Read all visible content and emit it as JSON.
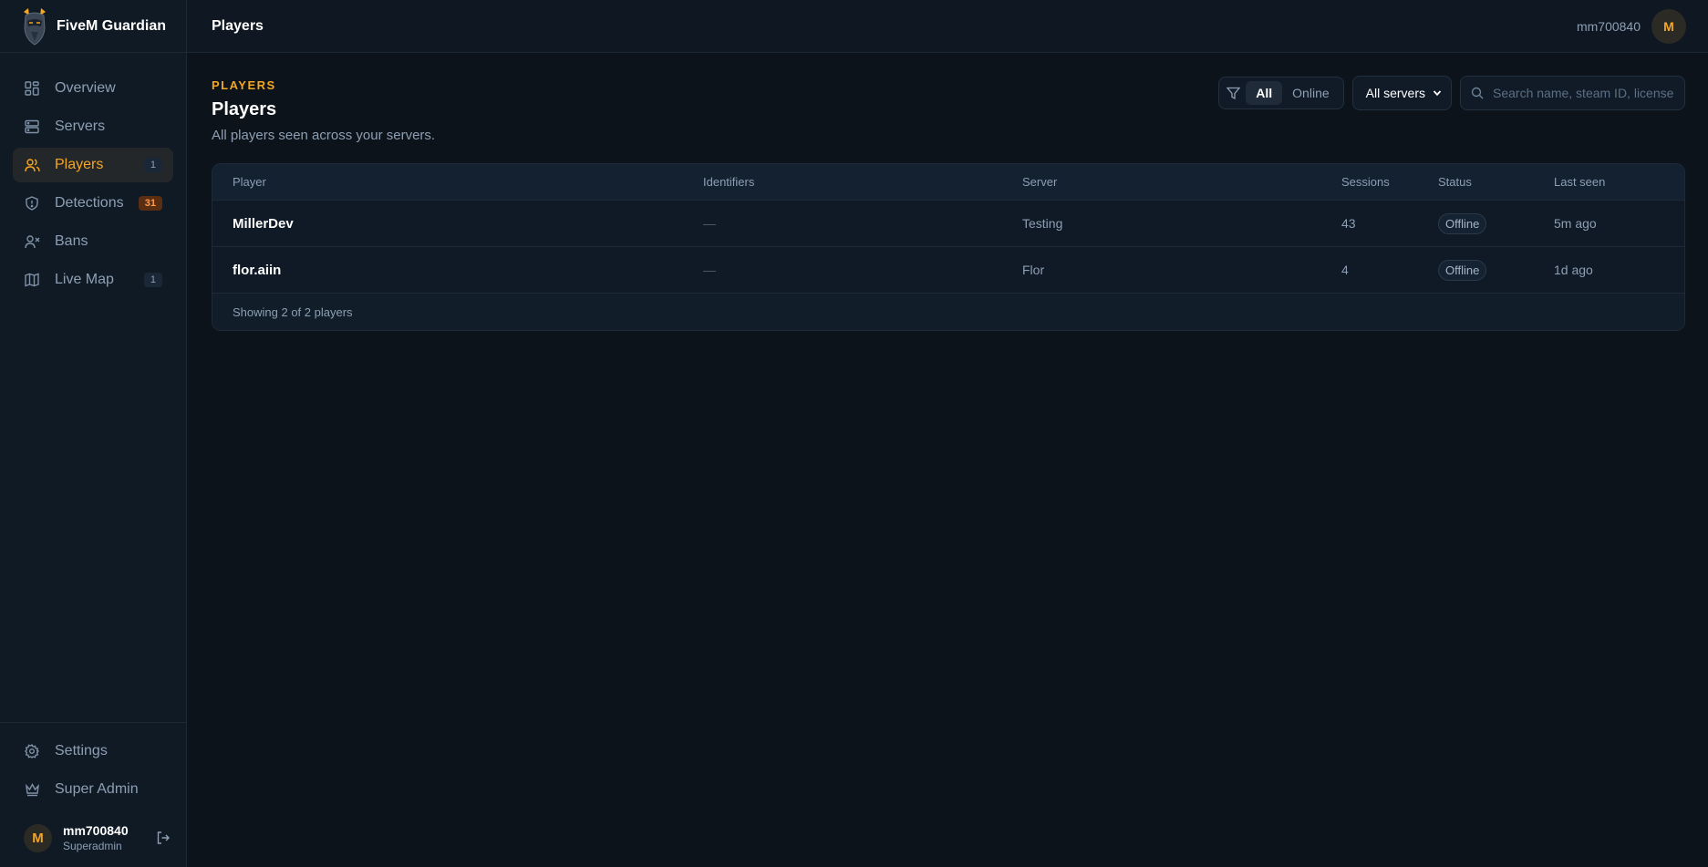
{
  "brand": {
    "name": "FiveM Guardian"
  },
  "sidebar": {
    "items": [
      {
        "label": "Overview",
        "badge": ""
      },
      {
        "label": "Servers",
        "badge": ""
      },
      {
        "label": "Players",
        "badge": "1"
      },
      {
        "label": "Detections",
        "badge": "31"
      },
      {
        "label": "Bans",
        "badge": ""
      },
      {
        "label": "Live Map",
        "badge": "1"
      }
    ],
    "bottom": [
      {
        "label": "Settings"
      },
      {
        "label": "Super Admin"
      }
    ],
    "user": {
      "initial": "M",
      "name": "mm700840",
      "role": "Superadmin"
    }
  },
  "topbar": {
    "title": "Players",
    "username": "mm700840",
    "initial": "M"
  },
  "page": {
    "eyebrow": "PLAYERS",
    "title": "Players",
    "subtitle": "All players seen across your servers."
  },
  "filters": {
    "all_label": "All",
    "online_label": "Online",
    "server_select": "All servers",
    "search_placeholder": "Search name, steam ID, license"
  },
  "table": {
    "headers": {
      "player": "Player",
      "identifiers": "Identifiers",
      "server": "Server",
      "sessions": "Sessions",
      "status": "Status",
      "last_seen": "Last seen"
    },
    "rows": [
      {
        "player": "MillerDev",
        "identifiers": "—",
        "server": "Testing",
        "sessions": "43",
        "status": "Offline",
        "last_seen": "5m ago"
      },
      {
        "player": "flor.aiin",
        "identifiers": "—",
        "server": "Flor",
        "sessions": "4",
        "status": "Offline",
        "last_seen": "1d ago"
      }
    ],
    "footer": "Showing 2 of 2 players"
  },
  "colors": {
    "accent": "#f5a623",
    "background": "#0c131b",
    "sidebar": "#0f1a25",
    "detections_badge": "#ff9a4a"
  }
}
